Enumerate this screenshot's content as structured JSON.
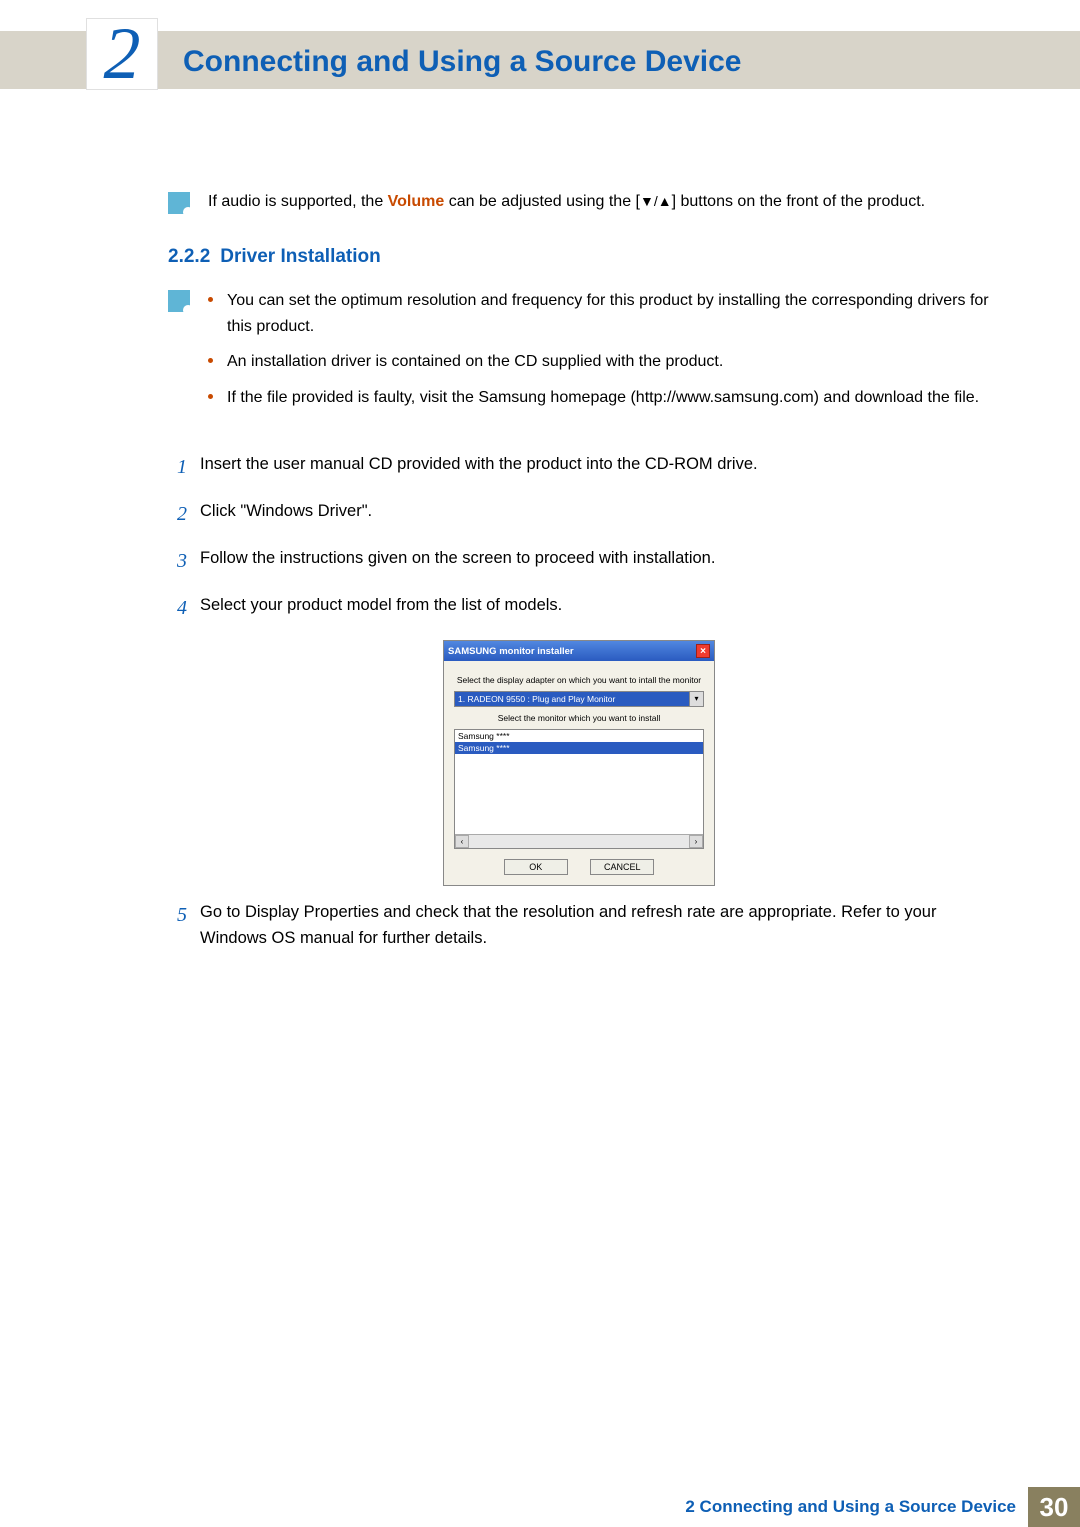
{
  "chapter": {
    "number": "2",
    "title": "Connecting and Using a Source Device"
  },
  "audio_note": {
    "prefix": "If audio is supported, the ",
    "volume_word": "Volume",
    "mid": " can be adjusted using the [",
    "buttons_glyph": "▼/▲",
    "suffix": "] buttons on the front of the product."
  },
  "section": {
    "number": "2.2.2",
    "title": "Driver Installation"
  },
  "note_bullets": [
    "You can set the optimum resolution and frequency for this product by installing the corresponding drivers for this product.",
    "An installation driver is contained on the CD supplied with the product.",
    "If the file provided is faulty, visit the Samsung homepage (http://www.samsung.com) and download the file."
  ],
  "steps": [
    {
      "n": "1",
      "text": "Insert the user manual CD provided with the product into the CD-ROM drive."
    },
    {
      "n": "2",
      "text": "Click \"Windows Driver\"."
    },
    {
      "n": "3",
      "text": "Follow the instructions given on the screen to proceed with installation."
    },
    {
      "n": "4",
      "text": "Select your product model from the list of models."
    },
    {
      "n": "5",
      "text": "Go to Display Properties and check that the resolution and refresh rate are appropriate. Refer to your Windows OS manual for further details."
    }
  ],
  "dialog": {
    "title": "SAMSUNG monitor installer",
    "label1": "Select the display adapter on which you want to intall the monitor",
    "combo": "1. RADEON 9550 : Plug and Play Monitor",
    "label2": "Select the monitor which you want to install",
    "list": [
      "Samsung ****",
      "Samsung ****"
    ],
    "ok": "OK",
    "cancel": "CANCEL"
  },
  "footer": {
    "text": "2 Connecting and Using a Source Device",
    "page": "30"
  }
}
